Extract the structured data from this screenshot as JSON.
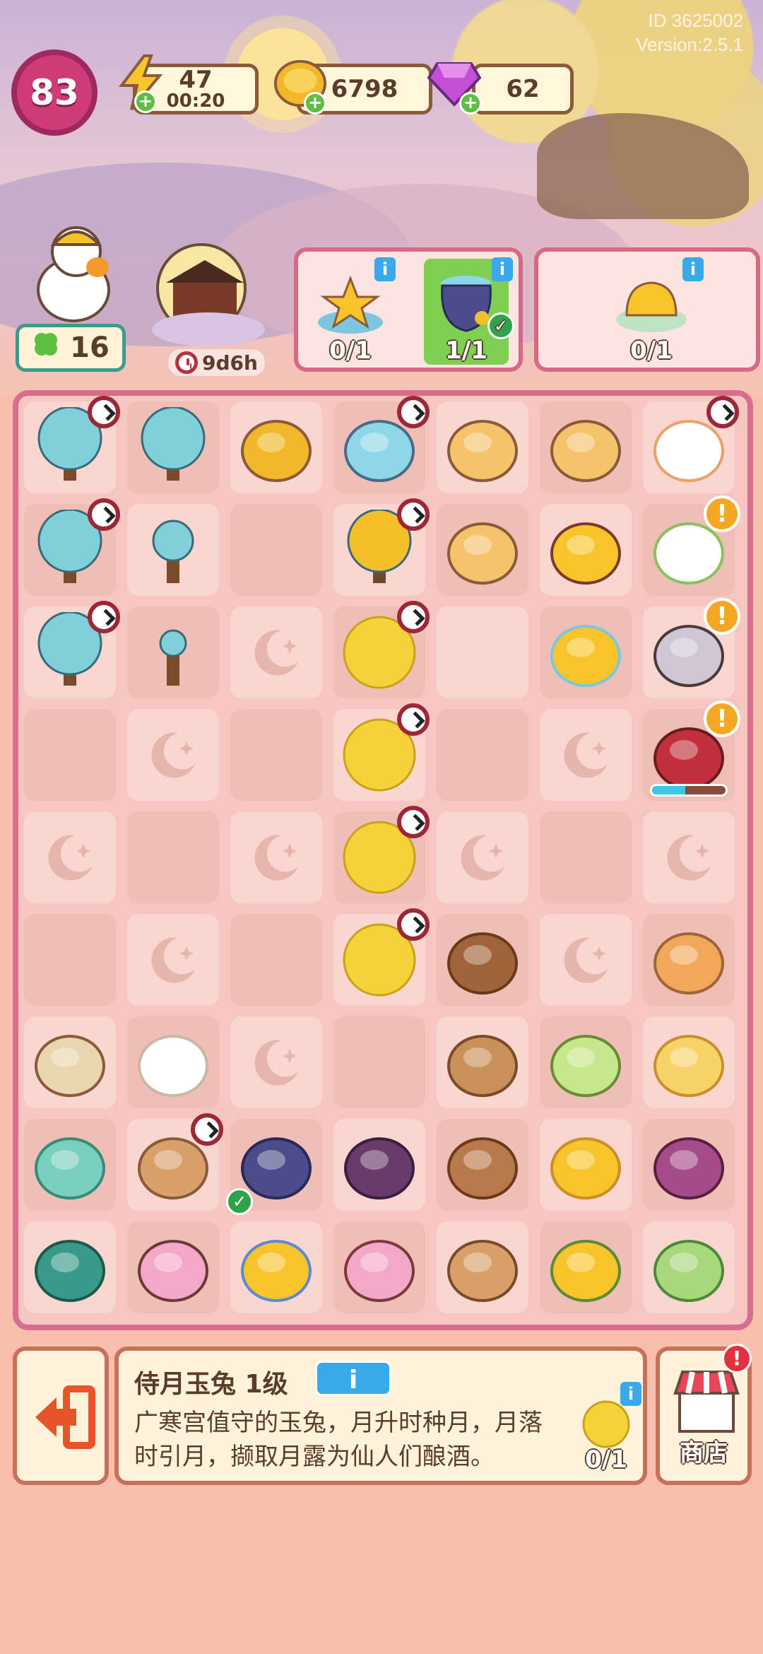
{
  "header": {
    "id_text": "ID 3625002",
    "version_text": "Version:2.5.1",
    "level": "83",
    "energy": {
      "value": "47",
      "timer": "00:20",
      "icon": "lightning-icon"
    },
    "coins": {
      "value": "6798",
      "icon": "coin-icon"
    },
    "gems": {
      "value": "62",
      "icon": "gem-icon"
    }
  },
  "left_panel": {
    "clover_count": "16",
    "event_timer": "9d6h"
  },
  "orders": [
    {
      "items": [
        {
          "name": "star-pile",
          "progress": "0/1"
        },
        {
          "name": "osmanthus-jar",
          "progress": "1/1",
          "done": true
        }
      ]
    },
    {
      "items": [
        {
          "name": "osmanthus-jelly",
          "progress": "0/1"
        }
      ]
    }
  ],
  "board": {
    "columns": 7,
    "rows": 9,
    "grid": [
      [
        "moon-tree",
        "blue-tree",
        "coin-pile",
        "palace-cloud",
        "star-lantern",
        "star-lantern",
        "rabbit-mortar"
      ],
      [
        "moon-tree",
        "blue-sapling",
        "empty",
        "osmanthus-tree",
        "star-lantern",
        "star-box",
        "rabbit-grinder"
      ],
      [
        "moon-tree",
        "sprout",
        "slot",
        "mooncake-moon",
        "empty",
        "star-bowl",
        "rabbit-pot"
      ],
      [
        "empty",
        "slot",
        "empty",
        "mooncake-moon",
        "empty",
        "slot",
        "red-pot"
      ],
      [
        "slot",
        "empty",
        "slot",
        "mooncake-moon",
        "slot",
        "empty",
        "slot"
      ],
      [
        "empty",
        "slot",
        "empty",
        "mooncake-moon",
        "acorn",
        "slot",
        "mooncake"
      ],
      [
        "thread-spool",
        "cloud",
        "slot",
        "empty",
        "mushroom-stack",
        "osmanthus-tea",
        "cheese-mooncake"
      ],
      [
        "jade-plate",
        "loom",
        "osmanthus-jar",
        "jam-jar",
        "pig-bread",
        "osmanthus-flower",
        "taro-mooncake"
      ],
      [
        "leaf-plate",
        "rabbit-cushion",
        "tea-set",
        "rabbit-cupcake",
        "rabbit-buns",
        "osmanthus-branch",
        "green-mooncake"
      ]
    ]
  },
  "selected": {
    "title": "侍月玉兔 1级",
    "info_label": "i",
    "description": "广寒宫值守的玉兔，月升时种月，月落时引月，撷取月露为仙人们酿酒。",
    "need_progress": "0/1"
  },
  "shop": {
    "label": "商店",
    "badge": "!"
  },
  "colors": {
    "board_border": "#d86e8e",
    "panel_border": "#c8705a",
    "info_blue": "#3aa9e9",
    "alert": "#f4a724"
  }
}
